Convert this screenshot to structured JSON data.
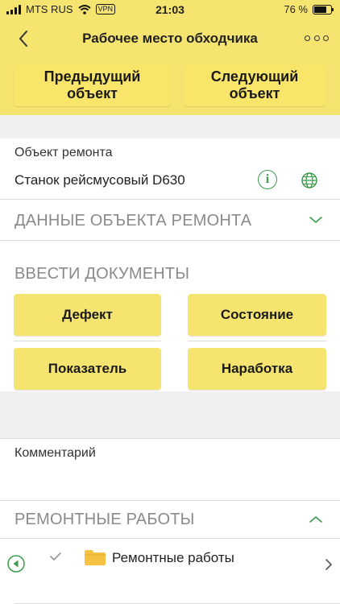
{
  "status": {
    "carrier": "MTS RUS",
    "vpn": "VPN",
    "time": "21:03",
    "battery_text": "76 %",
    "battery_level": 0.76
  },
  "nav": {
    "title": "Рабочее место обходчика"
  },
  "buttons": {
    "prev": "Предыдущий\nобъект",
    "next": "Следующий\nобъект"
  },
  "repair_object": {
    "label": "Объект ремонта",
    "value": "Станок рейсмусовый D630"
  },
  "sections": {
    "object_data": "ДАННЫЕ ОБЪЕКТА РЕМОНТА",
    "enter_docs": "ВВЕСТИ ДОКУМЕНТЫ",
    "repair_works": "РЕМОНТНЫЕ РАБОТЫ"
  },
  "doc_buttons": {
    "defect": "Дефект",
    "state": "Состояние",
    "indicator": "Показатель",
    "operating_time": "Наработка"
  },
  "comment": {
    "label": "Комментарий"
  },
  "repair_list": [
    {
      "title": "Ремонтные работы"
    }
  ],
  "colors": {
    "yellow": "#f6e470",
    "green": "#3c9a4c",
    "section_gray": "#8a8a8a"
  }
}
